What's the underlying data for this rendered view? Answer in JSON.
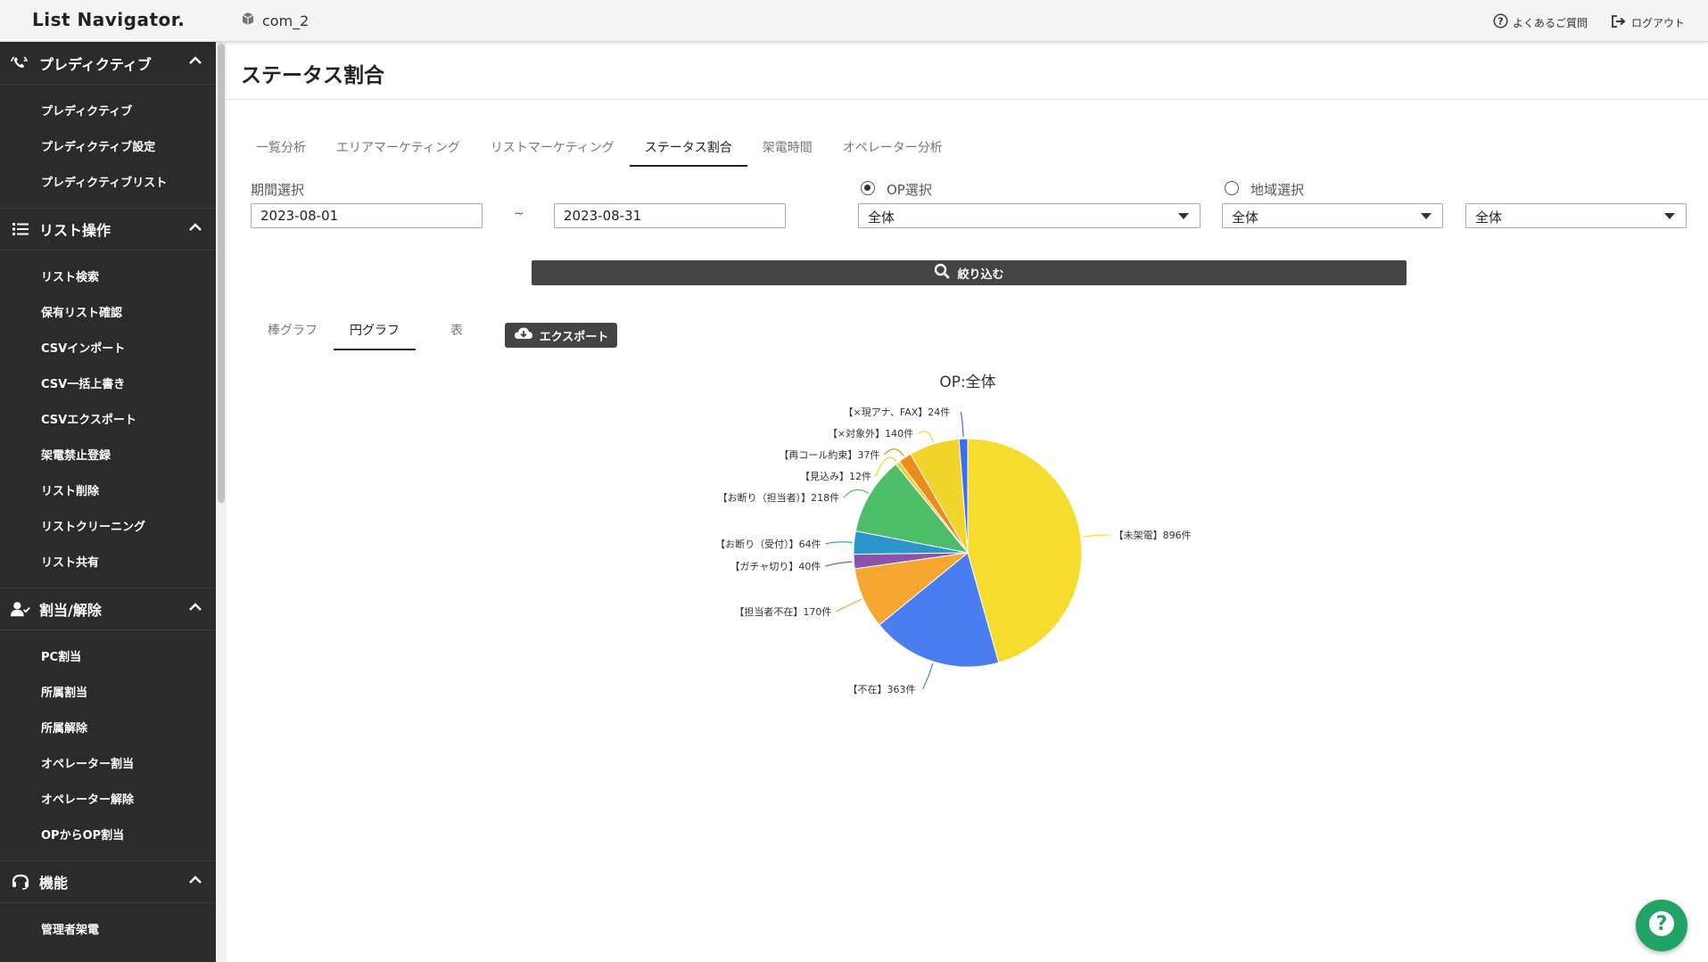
{
  "app": {
    "brand": "List Navigator.",
    "company": "com_2"
  },
  "header": {
    "faq_label": "よくあるご質問",
    "logout_label": "ログアウト"
  },
  "sidebar": {
    "sections": [
      {
        "title": "プレディクティブ",
        "icon": "phone-wave-icon",
        "items": [
          "プレディクティブ",
          "プレディクティブ設定",
          "プレディクティブリスト"
        ]
      },
      {
        "title": "リスト操作",
        "icon": "list-icon",
        "items": [
          "リスト検索",
          "保有リスト確認",
          "CSVインポート",
          "CSV一括上書き",
          "CSVエクスポート",
          "架電禁止登録",
          "リスト削除",
          "リストクリーニング",
          "リスト共有"
        ]
      },
      {
        "title": "割当/解除",
        "icon": "user-check-icon",
        "items": [
          "PC割当",
          "所属割当",
          "所属解除",
          "オペレーター割当",
          "オペレーター解除",
          "OPからOP割当"
        ]
      },
      {
        "title": "機能",
        "icon": "headset-icon",
        "items": [
          "管理者架電"
        ]
      }
    ]
  },
  "page": {
    "title": "ステータス割合"
  },
  "tabs": [
    "一覧分析",
    "エリアマーケティング",
    "リストマーケティング",
    "ステータス割合",
    "架電時間",
    "オペレーター分析"
  ],
  "active_tab": "ステータス割合",
  "filters": {
    "period_label": "期間選択",
    "start_date": "2023-08-01",
    "separator": "~",
    "end_date": "2023-08-31",
    "op_label": "OP選択",
    "op_value": "全体",
    "region_label": "地域選択",
    "region_value1": "全体",
    "region_value2": "全体",
    "op_selected": true,
    "filter_button": "絞り込む"
  },
  "view_tabs": [
    "棒グラフ",
    "円グラフ",
    "表"
  ],
  "active_view": "円グラフ",
  "export_label": "エクスポート",
  "chart_data": {
    "type": "pie",
    "title": "OP:全体",
    "slices": [
      {
        "label": "【未架電】896件",
        "value": 896,
        "color": "#f5dc2e"
      },
      {
        "label": "【不在】363件",
        "value": 363,
        "color": "#4a7ef0"
      },
      {
        "label": "【担当者不在】170件",
        "value": 170,
        "color": "#f5a731"
      },
      {
        "label": "【ガチャ切り】40件",
        "value": 40,
        "color": "#8a55a8"
      },
      {
        "label": "【お断り（受付）】64件",
        "value": 64,
        "color": "#2a96c9"
      },
      {
        "label": "【お断り（担当者）】218件",
        "value": 218,
        "color": "#4dbd6a"
      },
      {
        "label": "【見込み】12件",
        "value": 12,
        "color": "#f5cc2e"
      },
      {
        "label": "【再コール約束】37件",
        "value": 37,
        "color": "#ee8a1c"
      },
      {
        "label": "【×対象外】140件",
        "value": 140,
        "color": "#f2d52c"
      },
      {
        "label": "【×現アナ、FAX】24件",
        "value": 24,
        "color": "#3d6ef0"
      }
    ]
  }
}
